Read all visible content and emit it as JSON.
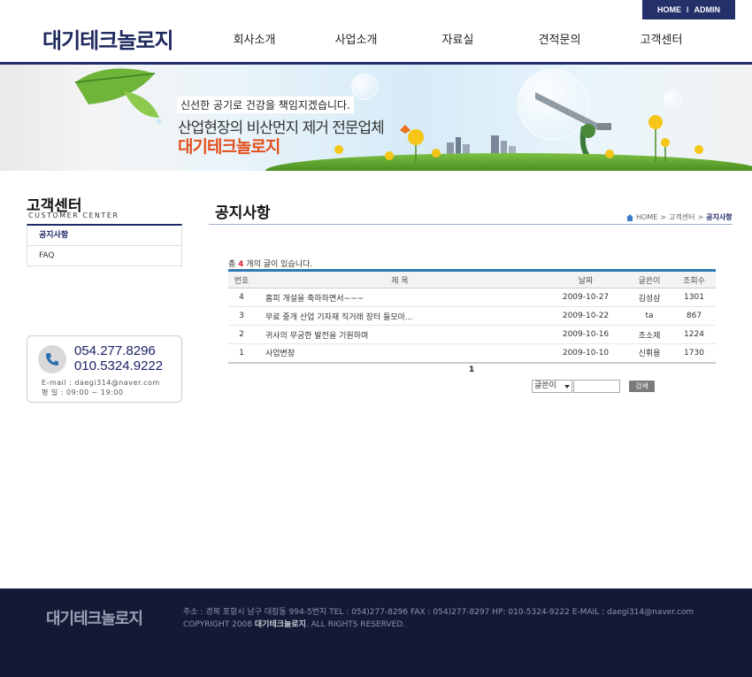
{
  "header": {
    "util_home": "HOME",
    "util_sep": "I",
    "util_admin": "ADMIN",
    "logo": "대기테크놀로지",
    "nav": [
      "회사소개",
      "사업소개",
      "자료실",
      "견적문의",
      "고객센터"
    ]
  },
  "banner": {
    "subtitle": "신선한 공기로 건강을 책임지겠습니다.",
    "headline": "산업현장의 비산먼지 제거 전문업체",
    "brand": "대기테크놀로지"
  },
  "sidebar": {
    "title": "고객센터",
    "title_en": "CUSTOMER CENTER",
    "items": [
      {
        "label": "공지사항",
        "active": true
      },
      {
        "label": "FAQ",
        "active": false
      }
    ]
  },
  "contact": {
    "tel1": "054.277.8296",
    "tel2": "010.5324.9222",
    "email": "E-mail : daegi314@naver.com",
    "hours": "평    일 : 09:00 ~ 19:00"
  },
  "content": {
    "page_title": "공지사항",
    "breadcrumb": [
      "HOME",
      "고객센터",
      "공지사항"
    ],
    "count_prefix": "총",
    "count": "4",
    "count_suffix": "개의 글이 있습니다.",
    "columns": [
      "번호",
      "제 목",
      "날짜",
      "글쓴이",
      "조회수"
    ],
    "rows": [
      {
        "no": "4",
        "subject": "홈피 개설을 축하하면서~~~",
        "date": "2009-10-27",
        "author": "김성삼",
        "views": "1301"
      },
      {
        "no": "3",
        "subject": "무료 중개 산업 기자재 직거래 장터 들모아...",
        "date": "2009-10-22",
        "author": "ta",
        "views": "867"
      },
      {
        "no": "2",
        "subject": "귀사의 무궁한 발전을 기원하며",
        "date": "2009-10-16",
        "author": "조소제",
        "views": "1224"
      },
      {
        "no": "1",
        "subject": "사업변창",
        "date": "2009-10-10",
        "author": "신휘용",
        "views": "1730"
      }
    ],
    "page": "1",
    "search_field": "글쓴이",
    "search_value": "",
    "search_button": "검색"
  },
  "footer": {
    "logo": "대기테크놀로지",
    "address": "주소 : 경북 포항시 남구 대잠동 994-5번지 TEL : 054)277-8296 FAX : 054)277-8297 HP: 010-5324-9222 E-MAIL : daegi314@naver.com",
    "copy_prefix": "COPYRIGHT 2008",
    "copy_brand": "대기테크놀로지",
    "copy_suffix": ". ALL RIGHTS RESERVED."
  }
}
